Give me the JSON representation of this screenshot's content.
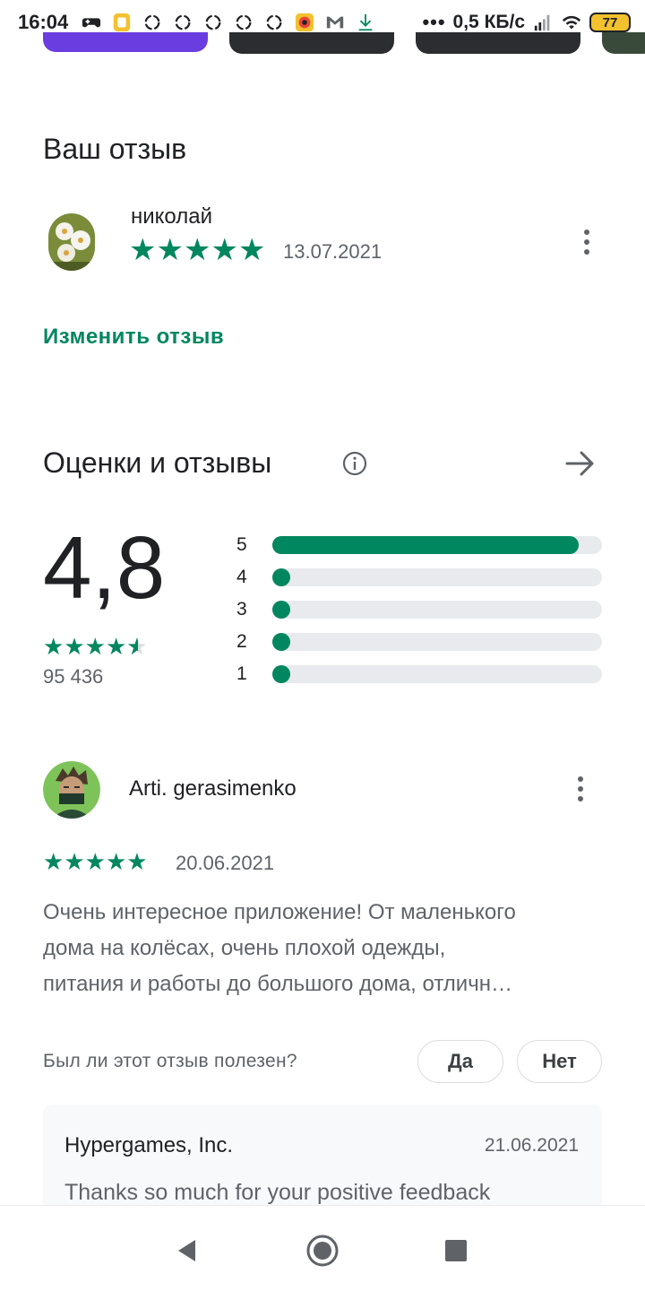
{
  "status_bar": {
    "time": "16:04",
    "speed": "0,5 КБ/с",
    "battery": "77",
    "icons": [
      "gamepad-icon",
      "sim-card-icon",
      "recycle-icon",
      "recycle-icon",
      "recycle-icon",
      "recycle-icon",
      "recycle-icon",
      "eye-app-icon",
      "gmail-icon",
      "download-icon",
      "more-dots-icon",
      "signal-icon",
      "wifi-icon",
      "battery-icon"
    ]
  },
  "your_review": {
    "title": "Ваш отзыв",
    "user_name": "николай",
    "stars": 5,
    "date": "13.07.2021",
    "edit_link": "Изменить отзыв"
  },
  "ratings": {
    "title": "Оценки и отзывы",
    "score": "4,8",
    "stars": 4.5,
    "count": "95 436",
    "distribution": [
      {
        "label": "5",
        "fraction": 0.93
      },
      {
        "label": "4",
        "fraction": 0.02
      },
      {
        "label": "3",
        "fraction": 0.01
      },
      {
        "label": "2",
        "fraction": 0.01
      },
      {
        "label": "1",
        "fraction": 0.02
      }
    ]
  },
  "review": {
    "user_name": "Arti. gerasimenko",
    "stars": 5,
    "date": "20.06.2021",
    "text_line1": "Очень интересное приложение! От маленького",
    "text_line2": "дома на колёсах, очень плохой одежды,",
    "text_line3": "питания и работы до большого дома, отличн…",
    "helpful_question": "Был ли этот отзыв полезен?",
    "yes": "Да",
    "no": "Нет"
  },
  "developer_reply": {
    "name": "Hypergames, Inc.",
    "date": "21.06.2021",
    "text": "Thanks so much for your positive feedback"
  },
  "colors": {
    "accent": "#01875f",
    "track": "#e8eaed",
    "text_primary": "#202124",
    "text_secondary": "#5f6368"
  }
}
